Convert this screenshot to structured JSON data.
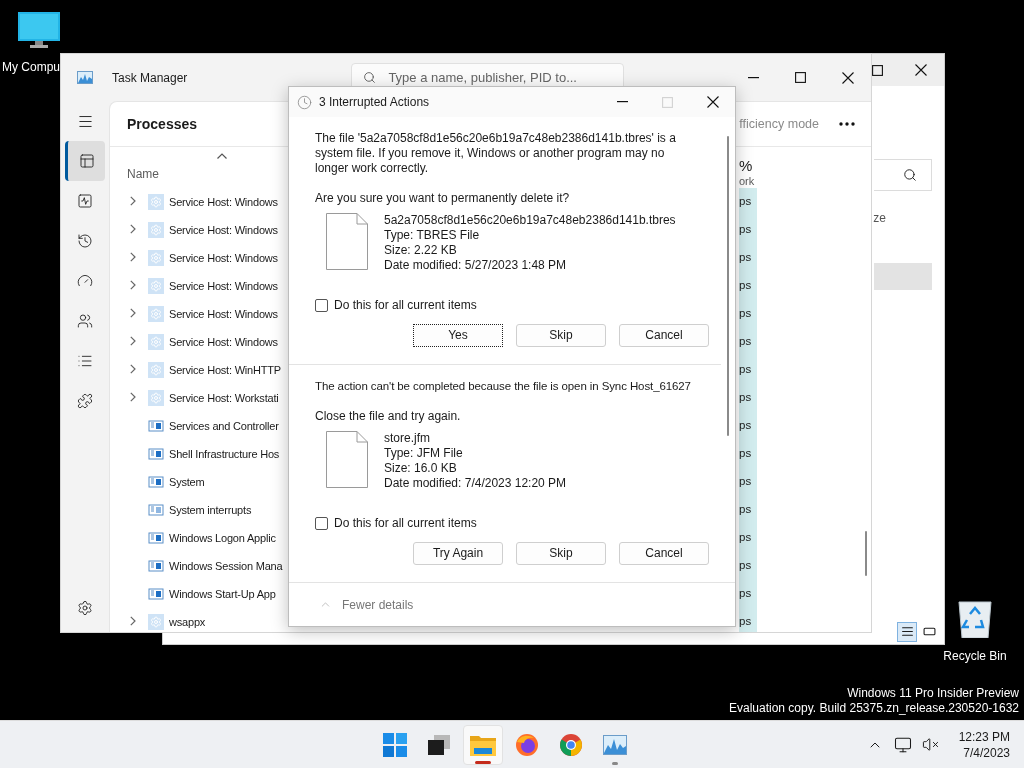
{
  "desktop_icons": [
    {
      "kind": "computer",
      "label": "My Compu"
    },
    {
      "kind": "recycle_bin",
      "label": "Recycle Bin"
    }
  ],
  "explorer_window": {
    "window_buttons": [
      {
        "kind": "maximize"
      },
      {
        "kind": "close"
      }
    ],
    "column_header": "ze",
    "views": [
      {
        "kind": "details",
        "selected": true
      },
      {
        "kind": "tiles",
        "selected": false
      }
    ]
  },
  "task_manager": {
    "title": "Task Manager",
    "search": {
      "placeholder": "Type a name, publisher, PID to..."
    },
    "window_buttons": [
      {
        "kind": "minimize"
      },
      {
        "kind": "maximize"
      },
      {
        "kind": "close"
      }
    ],
    "nav": [
      {
        "kind": "processes",
        "selected": true
      },
      {
        "kind": "performance",
        "selected": false
      },
      {
        "kind": "app_history",
        "selected": false
      },
      {
        "kind": "startup",
        "selected": false
      },
      {
        "kind": "users",
        "selected": false
      },
      {
        "kind": "details",
        "selected": false
      },
      {
        "kind": "services",
        "selected": false
      },
      {
        "kind": "settings",
        "selected": false
      }
    ],
    "page_title": "Processes",
    "toolbar_action": "fficiency mode",
    "columns": [
      {
        "label": "Name",
        "sorted": true
      },
      {
        "value": "%",
        "label": "ork",
        "sorted": false
      }
    ],
    "rows": [
      {
        "name": "Service Host: Windows",
        "kind": "service",
        "expandable": true,
        "column_2": "ps"
      },
      {
        "name": "Service Host: Windows",
        "kind": "service",
        "expandable": true,
        "column_2": "ps"
      },
      {
        "name": "Service Host: Windows",
        "kind": "service",
        "expandable": true,
        "column_2": "ps"
      },
      {
        "name": "Service Host: Windows",
        "kind": "service",
        "expandable": true,
        "column_2": "ps"
      },
      {
        "name": "Service Host: Windows",
        "kind": "service",
        "expandable": true,
        "column_2": "ps"
      },
      {
        "name": "Service Host: Windows",
        "kind": "service",
        "expandable": true,
        "column_2": "ps"
      },
      {
        "name": "Service Host: WinHTTP",
        "kind": "service",
        "expandable": true,
        "column_2": "ps"
      },
      {
        "name": "Service Host: Workstati",
        "kind": "service",
        "expandable": true,
        "column_2": "ps"
      },
      {
        "name": "Services and Controller",
        "kind": "app",
        "expandable": false,
        "column_2": "ps"
      },
      {
        "name": "Shell Infrastructure Hos",
        "kind": "app",
        "expandable": false,
        "column_2": "ps"
      },
      {
        "name": "System",
        "kind": "app",
        "expandable": false,
        "column_2": "ps"
      },
      {
        "name": "System interrupts",
        "kind": "interrupts",
        "expandable": false,
        "column_2": "ps"
      },
      {
        "name": "Windows Logon Applic",
        "kind": "app",
        "expandable": false,
        "column_2": "ps"
      },
      {
        "name": "Windows Session Mana",
        "kind": "app",
        "expandable": false,
        "column_2": "ps"
      },
      {
        "name": "Windows Start-Up App",
        "kind": "app",
        "expandable": false,
        "column_2": "ps"
      },
      {
        "name": "wsappx",
        "kind": "service",
        "expandable": true,
        "column_2": "ps"
      }
    ]
  },
  "dialog": {
    "title": "3 Interrupted Actions",
    "window_buttons": [
      {
        "kind": "minimize",
        "disabled": false
      },
      {
        "kind": "maximize",
        "disabled": true
      },
      {
        "kind": "close",
        "disabled": false
      }
    ],
    "items": [
      {
        "message": "The file '5a2a7058cf8d1e56c20e6b19a7c48eb2386d141b.tbres' is a system file. If you remove it, Windows or another program may no longer work correctly.",
        "prompt": "Are you sure you want to permanently delete it?",
        "file": {
          "name": "5a2a7058cf8d1e56c20e6b19a7c48eb2386d141b.tbres",
          "type": "Type: TBRES File",
          "size": "Size: 2.22 KB",
          "modified": "Date modified: 5/27/2023 1:48 PM"
        },
        "checkbox": {
          "label": "Do this for all current items",
          "checked": false
        },
        "buttons": [
          {
            "label": "Yes",
            "focused": true
          },
          {
            "label": "Skip",
            "focused": false
          },
          {
            "label": "Cancel",
            "focused": false
          }
        ]
      },
      {
        "message": "The action can't be completed because the file is open in Sync Host_61627",
        "prompt": "Close the file and try again.",
        "file": {
          "name": "store.jfm",
          "type": "Type: JFM File",
          "size": "Size: 16.0 KB",
          "modified": "Date modified: 7/4/2023 12:20 PM"
        },
        "checkbox": {
          "label": "Do this for all current items",
          "checked": false
        },
        "buttons": [
          {
            "label": "Try Again",
            "focused": false
          },
          {
            "label": "Skip",
            "focused": false
          },
          {
            "label": "Cancel",
            "focused": false
          }
        ]
      }
    ],
    "footer": "Fewer details"
  },
  "watermark_lines": [
    "Windows 11 Pro Insider Preview",
    "Evaluation copy. Build 25375.zn_release.230520-1632"
  ],
  "taskbar": {
    "apps": [
      {
        "kind": "start",
        "selected": false,
        "running": false
      },
      {
        "kind": "task_view",
        "selected": false,
        "running": false
      },
      {
        "kind": "file_explorer",
        "selected": true,
        "running": true
      },
      {
        "kind": "firefox",
        "selected": false,
        "running": false
      },
      {
        "kind": "chrome",
        "selected": false,
        "running": false
      },
      {
        "kind": "task_manager",
        "selected": false,
        "running": true
      }
    ],
    "tray": [
      {
        "kind": "overflow"
      },
      {
        "kind": "network"
      },
      {
        "kind": "volume_muted"
      }
    ],
    "time": "12:23 PM",
    "date": "7/4/2023"
  }
}
